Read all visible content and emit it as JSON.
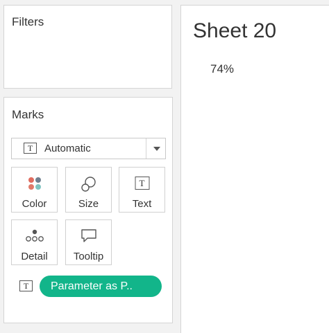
{
  "filters": {
    "title": "Filters"
  },
  "marks": {
    "title": "Marks",
    "mark_type": {
      "selected": "Automatic",
      "icon": "text-mark-icon"
    },
    "buttons": [
      {
        "label": "Color",
        "icon": "color-dots-icon"
      },
      {
        "label": "Size",
        "icon": "size-circles-icon"
      },
      {
        "label": "Text",
        "icon": "text-mark-icon"
      },
      {
        "label": "Detail",
        "icon": "detail-dots-icon"
      },
      {
        "label": "Tooltip",
        "icon": "tooltip-bubble-icon"
      }
    ],
    "pill": {
      "label": "Parameter as P..",
      "icon": "text-mark-icon",
      "color": "#12b58a"
    }
  },
  "sheet": {
    "title": "Sheet 20",
    "value": "74%"
  },
  "colors": {
    "pill": "#12b58a",
    "color_dots": [
      "#e06c5f",
      "#6f7f8f",
      "#7fc4c0",
      "#e07a6a"
    ]
  }
}
